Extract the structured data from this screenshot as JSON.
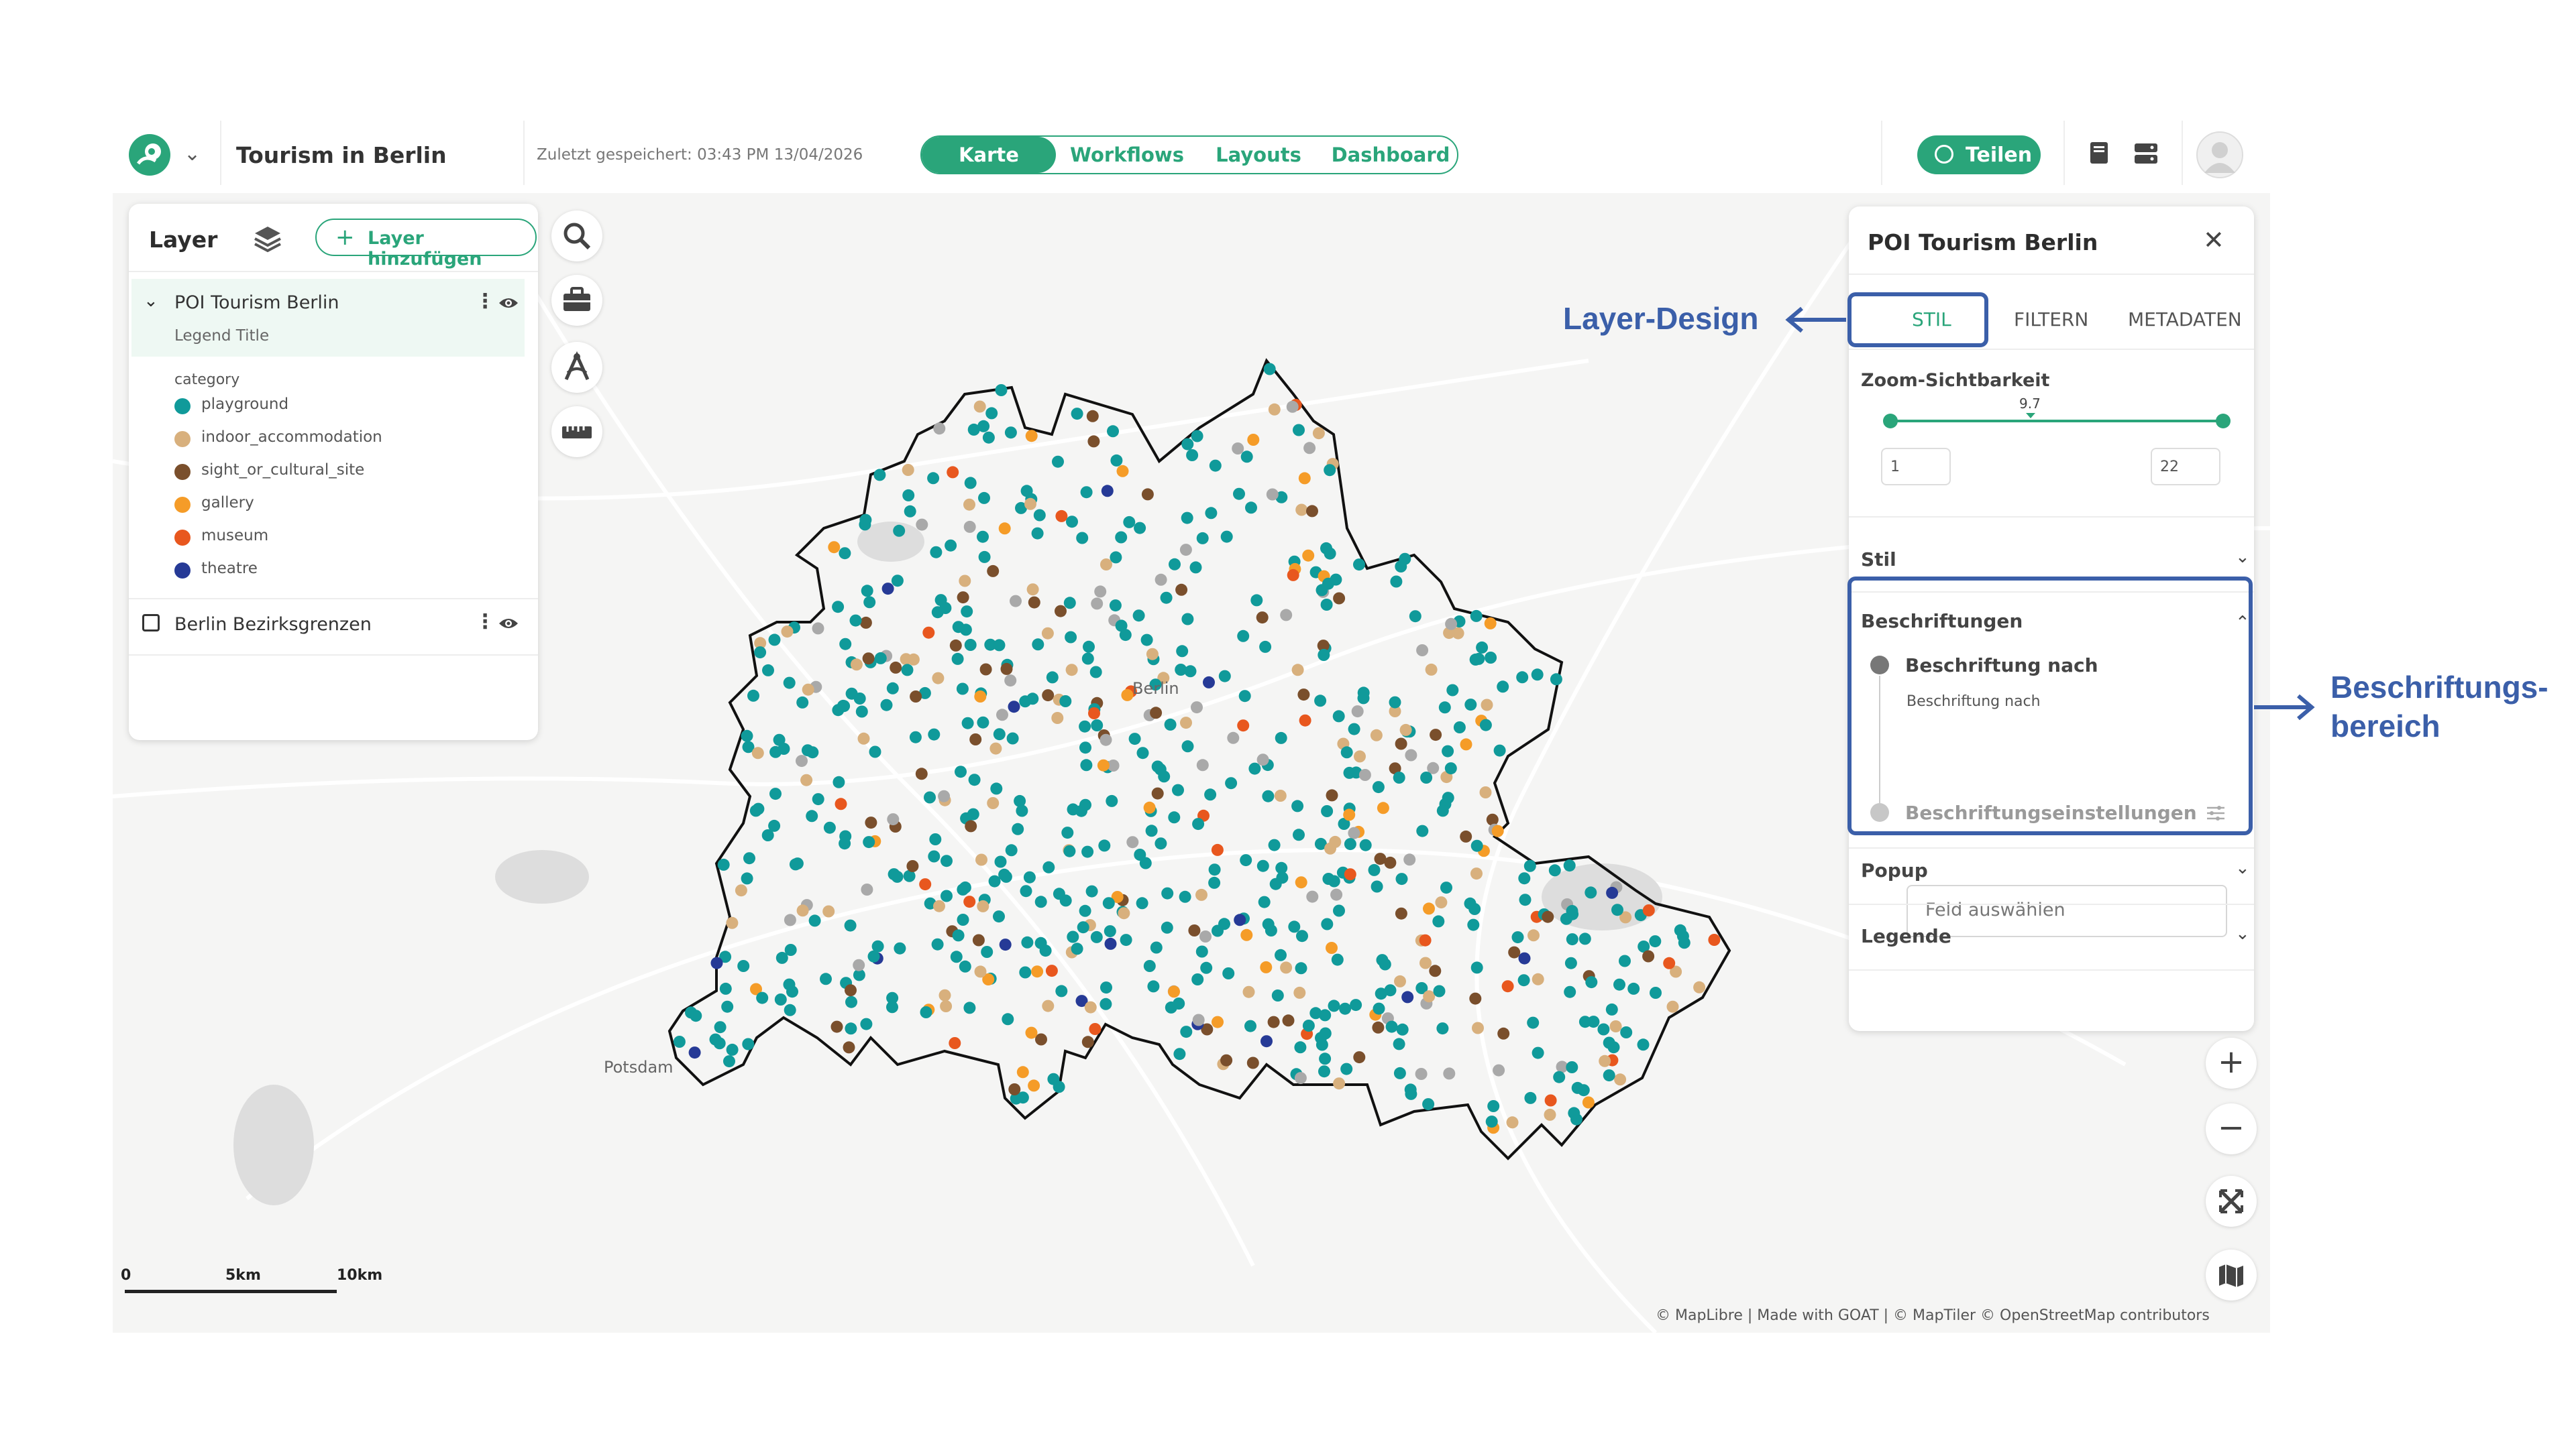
{
  "header": {
    "project_title": "Tourism in Berlin",
    "saved_text": "Zuletzt gespeichert: 03:43 PM 13/04/2026",
    "tabs": [
      {
        "label": "Karte",
        "active": true
      },
      {
        "label": "Workflows",
        "active": false
      },
      {
        "label": "Layouts",
        "active": false
      },
      {
        "label": "Dashboard",
        "active": false
      }
    ],
    "share_label": "Teilen",
    "accent_color": "#2aa57a"
  },
  "layer_panel": {
    "title": "Layer",
    "add_button": "Layer hinzufügen",
    "layers": [
      {
        "name": "POI Tourism Berlin",
        "subtitle": "Legend Title",
        "expanded": true
      },
      {
        "name": "Berlin Bezirksgrenzen",
        "expanded": false
      }
    ],
    "legend_field": "category",
    "legend": [
      {
        "label": "playground",
        "color": "#109a9a"
      },
      {
        "label": "indoor_accommodation",
        "color": "#d8b07d"
      },
      {
        "label": "sight_or_cultural_site",
        "color": "#7a4f2c"
      },
      {
        "label": "gallery",
        "color": "#f59c28"
      },
      {
        "label": "museum",
        "color": "#e8571e"
      },
      {
        "label": "theatre",
        "color": "#263a96"
      }
    ]
  },
  "tools": [
    "search-icon",
    "toolbox-icon",
    "draw-icon",
    "ruler-icon"
  ],
  "map": {
    "city_label": "Berlin",
    "potsdam_label": "Potsdam",
    "scale": [
      "0",
      "5km",
      "10km"
    ],
    "attribution": "© MapLibre | Made with GOAT | © MapTiler © OpenStreetMap contributors"
  },
  "settings_panel": {
    "title": "POI Tourism Berlin",
    "tabs": [
      {
        "label": "STIL",
        "active": true
      },
      {
        "label": "FILTERN",
        "active": false
      },
      {
        "label": "METADATEN",
        "active": false
      }
    ],
    "zoom_label": "Zoom-Sichtbarkeit",
    "zoom_current": "9.7",
    "zoom_min": "1",
    "zoom_max": "22",
    "sections": {
      "stil": "Stil",
      "labels": "Beschriftungen",
      "label_by": "Beschriftung nach",
      "label_by_field": "Beschriftung nach",
      "field_placeholder": "Feld auswählen",
      "label_settings": "Beschriftungseinstellungen",
      "popup": "Popup",
      "legend": "Legende"
    }
  },
  "annotations": {
    "layer_design": "Layer-Design",
    "label_area_line1": "Beschriftungs-",
    "label_area_line2": "bereich",
    "color": "#3b5fa9"
  }
}
